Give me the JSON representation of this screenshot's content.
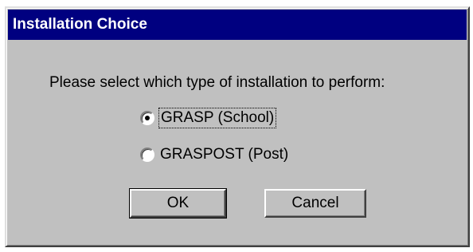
{
  "window": {
    "title": "Installation Choice"
  },
  "main": {
    "prompt": "Please select which type of installation to perform:",
    "options": [
      {
        "label": "GRASP (School)",
        "selected": true
      },
      {
        "label": "GRASPOST (Post)",
        "selected": false
      }
    ]
  },
  "buttons": {
    "ok_label": "OK",
    "cancel_label": "Cancel"
  },
  "colors": {
    "titlebar": "#000080",
    "dialog_face": "#c0c0c0"
  }
}
